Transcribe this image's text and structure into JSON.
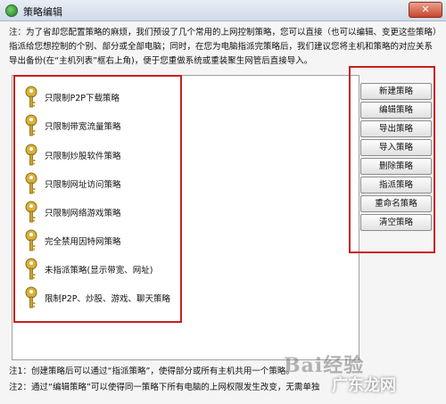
{
  "window": {
    "title": "策略编辑",
    "close_label": "✕"
  },
  "note": "注：为了省却您配置策略的麻烦，我们预设了几个常用的上网控制策略，您可以直接（也可以编辑、变更这些策略）指派给您想控制的个别、部分或全部电脑；同时，在您为电脑指派完策略后，我们建议您将主机和策略的对应关系导出备份(在“主机列表”框右上角)，便于您重做系统或重装聚生网管后直接导入。",
  "policies": [
    {
      "label": "只限制P2P下载策略"
    },
    {
      "label": "只限制带宽流量策略"
    },
    {
      "label": "只限制炒股软件策略"
    },
    {
      "label": "只限制网址访问策略"
    },
    {
      "label": "只限制网络游戏策略"
    },
    {
      "label": "完全禁用因特网策略"
    },
    {
      "label": "未指派策略(显示带宽、网址)"
    },
    {
      "label": "限制P2P、炒股、游戏、聊天策略"
    }
  ],
  "buttons": {
    "new": "新建策略",
    "edit": "编辑策略",
    "export": "导出策略",
    "import": "导入策略",
    "delete": "删除策略",
    "assign": "指派策略",
    "rename": "重命名策略",
    "clear": "清空策略"
  },
  "footnotes": [
    "注1：创建策略后可以通过“指派策略”，使得部分或所有主机共用一个策略。",
    "注2：通过“编辑策略”可以使得同一策略下所有电脑的上网权限发生改变，无需单独"
  ],
  "watermark": {
    "line1": "Bai经验",
    "line2": "广东龙网"
  },
  "colors": {
    "highlight_border": "#c8201e",
    "key_gold": "#d9b23a"
  }
}
